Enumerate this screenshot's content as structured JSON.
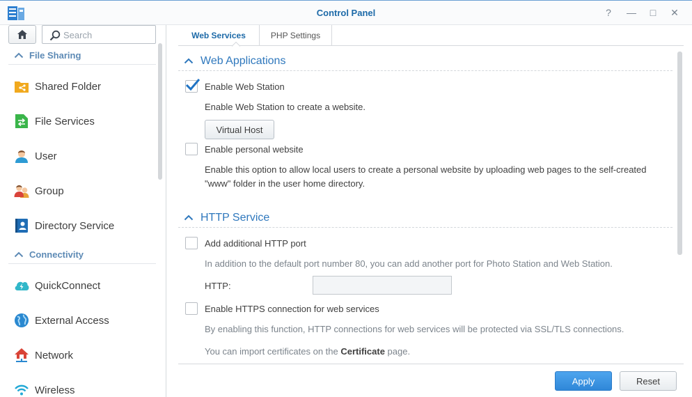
{
  "window": {
    "title": "Control Panel",
    "buttons": [
      "?",
      "—",
      "□",
      "✕"
    ]
  },
  "sidebar": {
    "search_placeholder": "Search",
    "sections": [
      {
        "label": "File Sharing",
        "items": [
          {
            "label": "Shared Folder",
            "icon": "shared-folder-icon"
          },
          {
            "label": "File Services",
            "icon": "file-services-icon"
          },
          {
            "label": "User",
            "icon": "user-icon"
          },
          {
            "label": "Group",
            "icon": "group-icon"
          },
          {
            "label": "Directory Service",
            "icon": "directory-service-icon"
          }
        ]
      },
      {
        "label": "Connectivity",
        "items": [
          {
            "label": "QuickConnect",
            "icon": "quickconnect-icon"
          },
          {
            "label": "External Access",
            "icon": "external-access-icon"
          },
          {
            "label": "Network",
            "icon": "network-icon"
          },
          {
            "label": "Wireless",
            "icon": "wireless-icon"
          }
        ]
      }
    ]
  },
  "tabs": [
    {
      "label": "Web Services",
      "active": true
    },
    {
      "label": "PHP Settings",
      "active": false
    }
  ],
  "web_applications": {
    "title": "Web Applications",
    "enable_web_station": {
      "label": "Enable Web Station",
      "checked": true
    },
    "web_station_desc": "Enable Web Station to create a website.",
    "virtual_host_button": "Virtual Host",
    "enable_personal_website": {
      "label": "Enable personal website",
      "checked": false
    },
    "personal_desc_line1": "Enable this option to allow local users to create a personal website by uploading web pages to the self-created",
    "personal_desc_line2": "\"www\" folder in the user home directory."
  },
  "http_service": {
    "title": "HTTP Service",
    "additional_port": {
      "label": "Add additional HTTP port",
      "checked": false
    },
    "additional_port_desc": "In addition to the default port number 80, you can add another port for Photo Station and Web Station.",
    "http_label": "HTTP:",
    "http_value": "",
    "enable_https": {
      "label": "Enable HTTPS connection for web services",
      "checked": false
    },
    "https_desc": "By enabling this function, HTTP connections for web services will be protected via SSL/TLS connections.",
    "cert_prefix": "You can import certificates on the ",
    "cert_link": "Certificate",
    "cert_suffix": " page."
  },
  "footer": {
    "apply": "Apply",
    "reset": "Reset"
  },
  "colors": {
    "accent": "#2f78bd",
    "apply_button": "#3890e0"
  }
}
